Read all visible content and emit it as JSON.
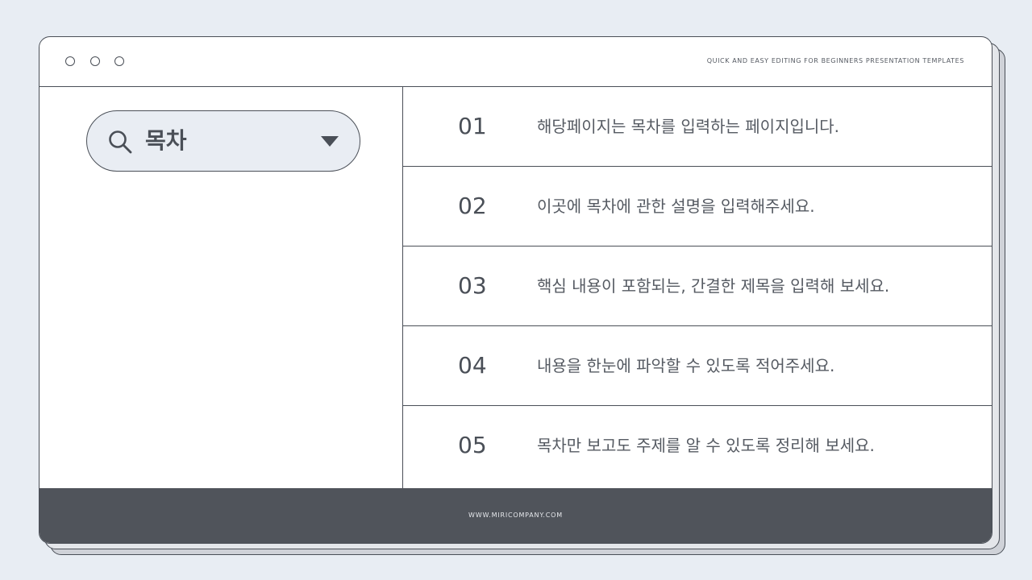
{
  "window": {
    "tagline": "QUICK AND EASY EDITING FOR BEGINNERS PRESENTATION TEMPLATES"
  },
  "search": {
    "label": "목차",
    "icon": "search-icon",
    "dropdown_icon": "caret-down-icon"
  },
  "toc": {
    "items": [
      {
        "number": "01",
        "text": "해당페이지는 목차를 입력하는 페이지입니다."
      },
      {
        "number": "02",
        "text": "이곳에 목차에 관한 설명을 입력해주세요."
      },
      {
        "number": "03",
        "text": "핵심 내용이 포함되는, 간결한 제목을 입력해 보세요."
      },
      {
        "number": "04",
        "text": "내용을 한눈에 파악할 수 있도록 적어주세요."
      },
      {
        "number": "05",
        "text": "목차만 보고도 주제를 알 수 있도록 정리해 보세요."
      }
    ]
  },
  "footer": {
    "url": "WWW.MIRICOMPANY.COM"
  },
  "colors": {
    "background": "#e8edf3",
    "outline": "#4a4f57",
    "footer": "#50545b",
    "search_fill": "#e9edf3"
  }
}
